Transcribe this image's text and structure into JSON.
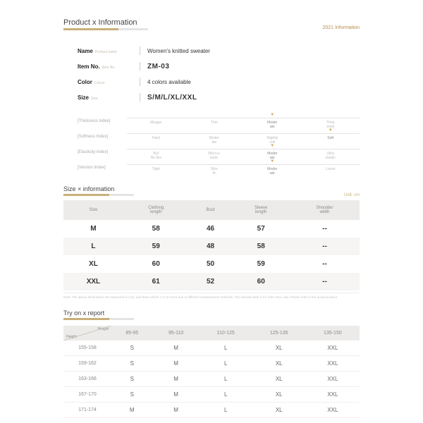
{
  "header": {
    "title": "Product x Information",
    "right": "2021 Information"
  },
  "info": {
    "rows": [
      {
        "label": "Name",
        "sub": "Product name",
        "value": "Women's knitted sweater",
        "strong": false
      },
      {
        "label": "Item No.",
        "sub": "Item No.",
        "value": "ZM-03",
        "strong": true
      },
      {
        "label": "Color",
        "sub": "Colour",
        "value": "4 colors available",
        "strong": false
      },
      {
        "label": "Size",
        "sub": "Size",
        "value": "S/M/L/XL/XXL",
        "strong": true
      }
    ]
  },
  "attrs": [
    {
      "label": "[Thickness index]",
      "opts": [
        "Meager",
        "Thin",
        "Moder ate",
        "Thick ened"
      ],
      "sel": 2
    },
    {
      "label": "[Softness Index]",
      "opts": [
        "Hard",
        "Moder ate",
        "Slightly soft",
        "Soft"
      ],
      "sel": 3
    },
    {
      "label": "[Elasticity index]",
      "opts": [
        "But No flex",
        "Micro-e lastic",
        "Moder ate",
        "Ultra elastic"
      ],
      "sel": 2
    },
    {
      "label": "[Version Index]",
      "opts": [
        "Tight",
        "Slim fit",
        "Moder ate",
        "Loose"
      ],
      "sel": 2
    }
  ],
  "sizeSection": {
    "title": "Size × information",
    "unit": "Unit: cm",
    "headers": [
      "Size",
      "Clothing length",
      "Bust",
      "Sleeve length",
      "Shoulder width"
    ],
    "rows": [
      [
        "M",
        "58",
        "46",
        "57",
        "--"
      ],
      [
        "L",
        "59",
        "48",
        "58",
        "--"
      ],
      [
        "XL",
        "60",
        "50",
        "59",
        "--"
      ],
      [
        "XXL",
        "61",
        "52",
        "60",
        "--"
      ]
    ],
    "note": "Note: The above dimensions are measured in inch, and there will be 1-3 cm error due to different measurement methods. The relevant data is for refer ence only. Please refer to the actual product."
  },
  "tryOn": {
    "title": "Try on x report",
    "corner": {
      "w": "Weight",
      "h": "Height"
    },
    "cols": [
      "85-95",
      "95-110",
      "110-125",
      "125-135",
      "135-150"
    ],
    "rows": [
      {
        "h": "155-158",
        "v": [
          "S",
          "M",
          "L",
          "XL",
          "XXL"
        ]
      },
      {
        "h": "159-162",
        "v": [
          "S",
          "M",
          "L",
          "XL",
          "XXL"
        ]
      },
      {
        "h": "163-166",
        "v": [
          "S",
          "M",
          "L",
          "XL",
          "XXL"
        ]
      },
      {
        "h": "167-170",
        "v": [
          "S",
          "M",
          "L",
          "XL",
          "XXL"
        ]
      },
      {
        "h": "171-174",
        "v": [
          "M",
          "M",
          "L",
          "XL",
          "XXL"
        ]
      }
    ]
  }
}
